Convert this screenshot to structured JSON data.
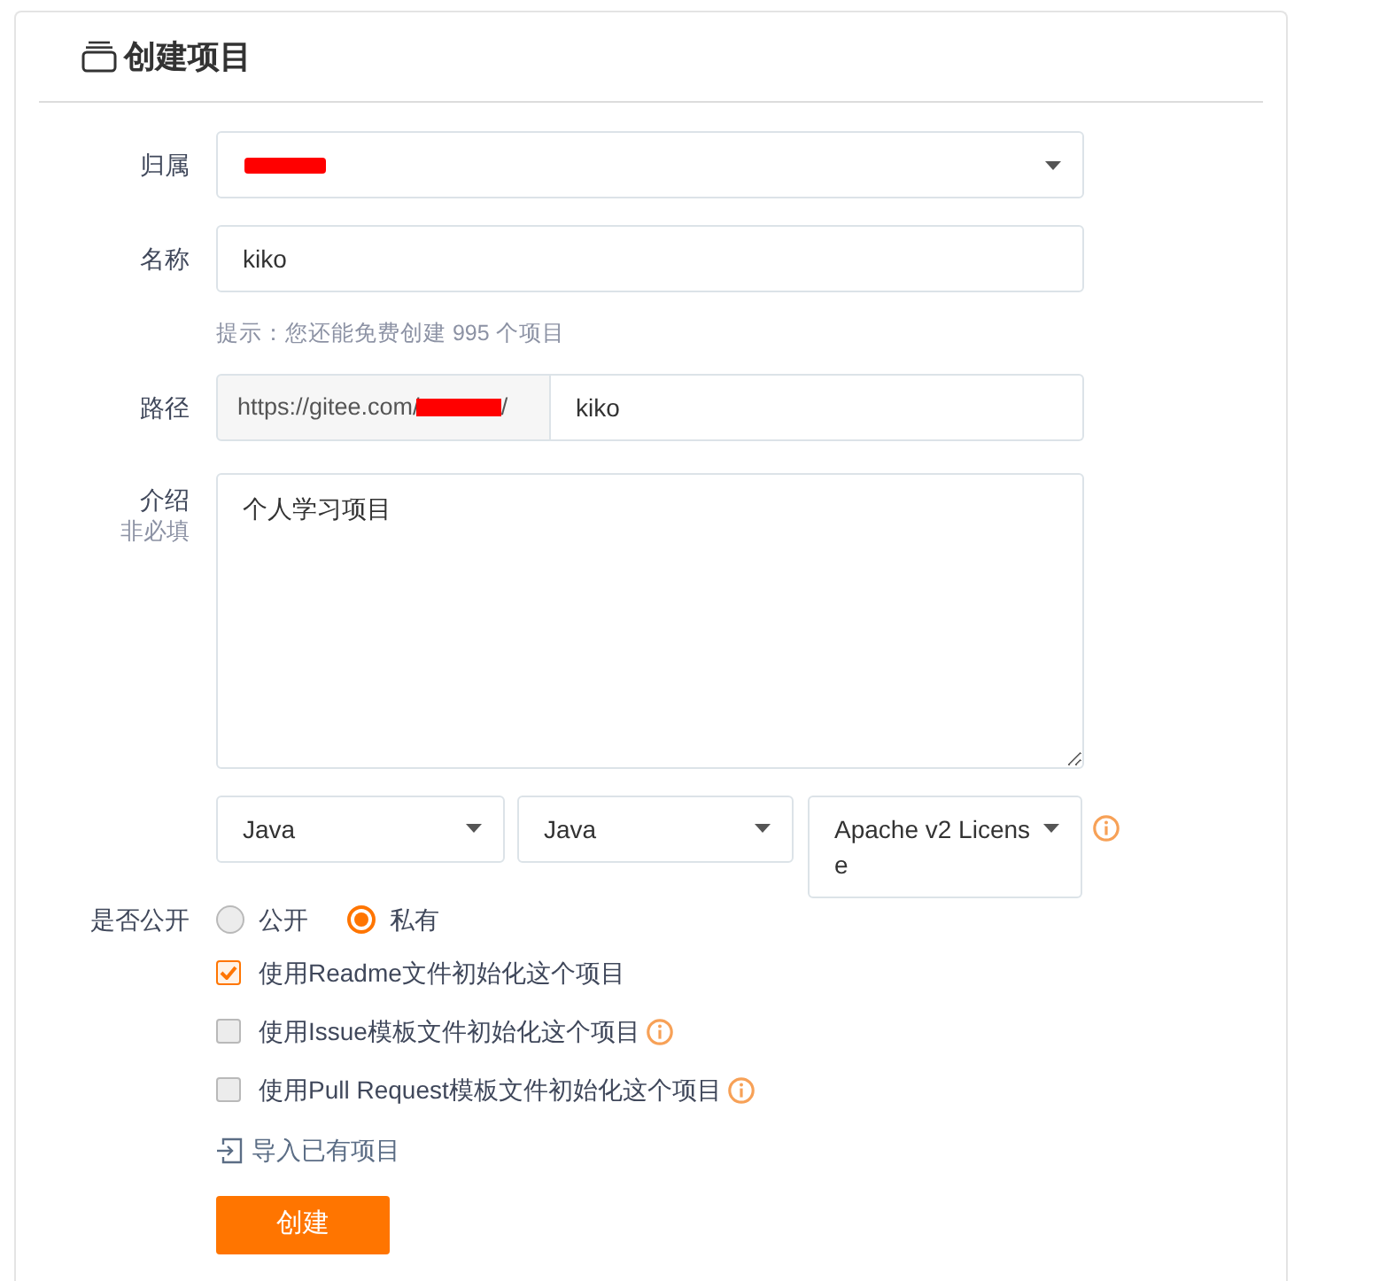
{
  "header": {
    "title": "创建项目"
  },
  "form": {
    "owner": {
      "label": "归属",
      "redacted": true
    },
    "name": {
      "label": "名称",
      "value": "kiko",
      "hint": "提示：您还能免费创建 995 个项目"
    },
    "path": {
      "label": "路径",
      "prefix": "https://gitee.com/",
      "redacted": true,
      "prefix_end": "/",
      "value": "kiko"
    },
    "description": {
      "label": "介绍",
      "sublabel": "非必填",
      "value": "个人学习项目"
    },
    "selects": [
      {
        "value": "Java",
        "info": false
      },
      {
        "value": "Java",
        "info": false
      },
      {
        "value": "Apache v2 License",
        "info": true
      }
    ],
    "visibility": {
      "label": "是否公开",
      "options": [
        {
          "label": "公开",
          "selected": false
        },
        {
          "label": "私有",
          "selected": true
        }
      ]
    },
    "options": [
      {
        "label": "使用Readme文件初始化这个项目",
        "checked": true,
        "info": false
      },
      {
        "label": "使用Issue模板文件初始化这个项目",
        "checked": false,
        "info": true
      },
      {
        "label": "使用Pull Request模板文件初始化这个项目",
        "checked": false,
        "info": true
      }
    ],
    "import_link": {
      "label": "导入已有项目"
    },
    "submit": {
      "label": "创建"
    }
  }
}
